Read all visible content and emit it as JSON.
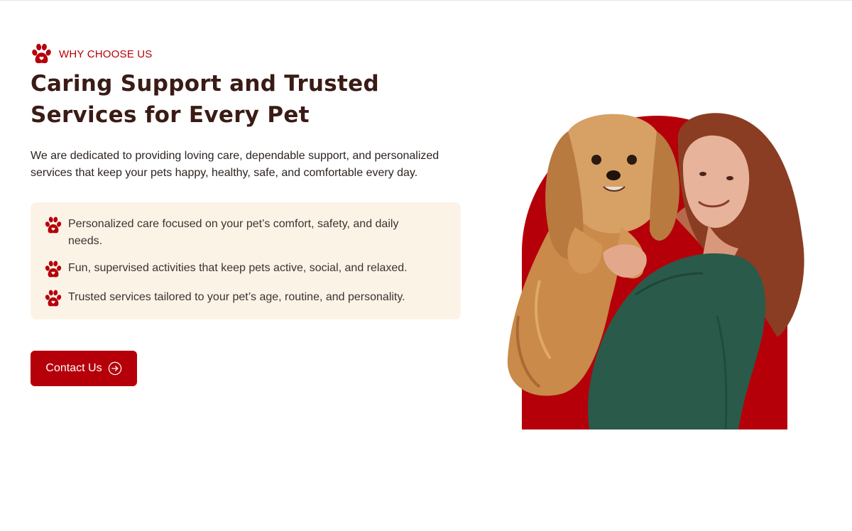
{
  "eyebrow": {
    "icon": "paw-icon",
    "label": "WHY CHOOSE US"
  },
  "heading": "Caring Support and Trusted Services for Every Pet",
  "description": "We are dedicated to providing loving care, dependable support, and personalized services that keep your pets happy, healthy, safe, and comfortable every day.",
  "features": [
    {
      "icon": "paw-icon",
      "text": "Personalized care focused on your pet’s comfort, safety, and daily needs."
    },
    {
      "icon": "paw-icon",
      "text": "Fun, supervised activities that keep pets active, social, and relaxed."
    },
    {
      "icon": "paw-icon",
      "text": "Trusted services tailored to your pet’s age, routine, and personality."
    }
  ],
  "cta": {
    "label": "Contact Us",
    "icon": "arrow-right-circle-icon"
  },
  "colors": {
    "brand": "#b5000a",
    "heading": "#3a1b15",
    "panel": "#fcf3e7"
  }
}
